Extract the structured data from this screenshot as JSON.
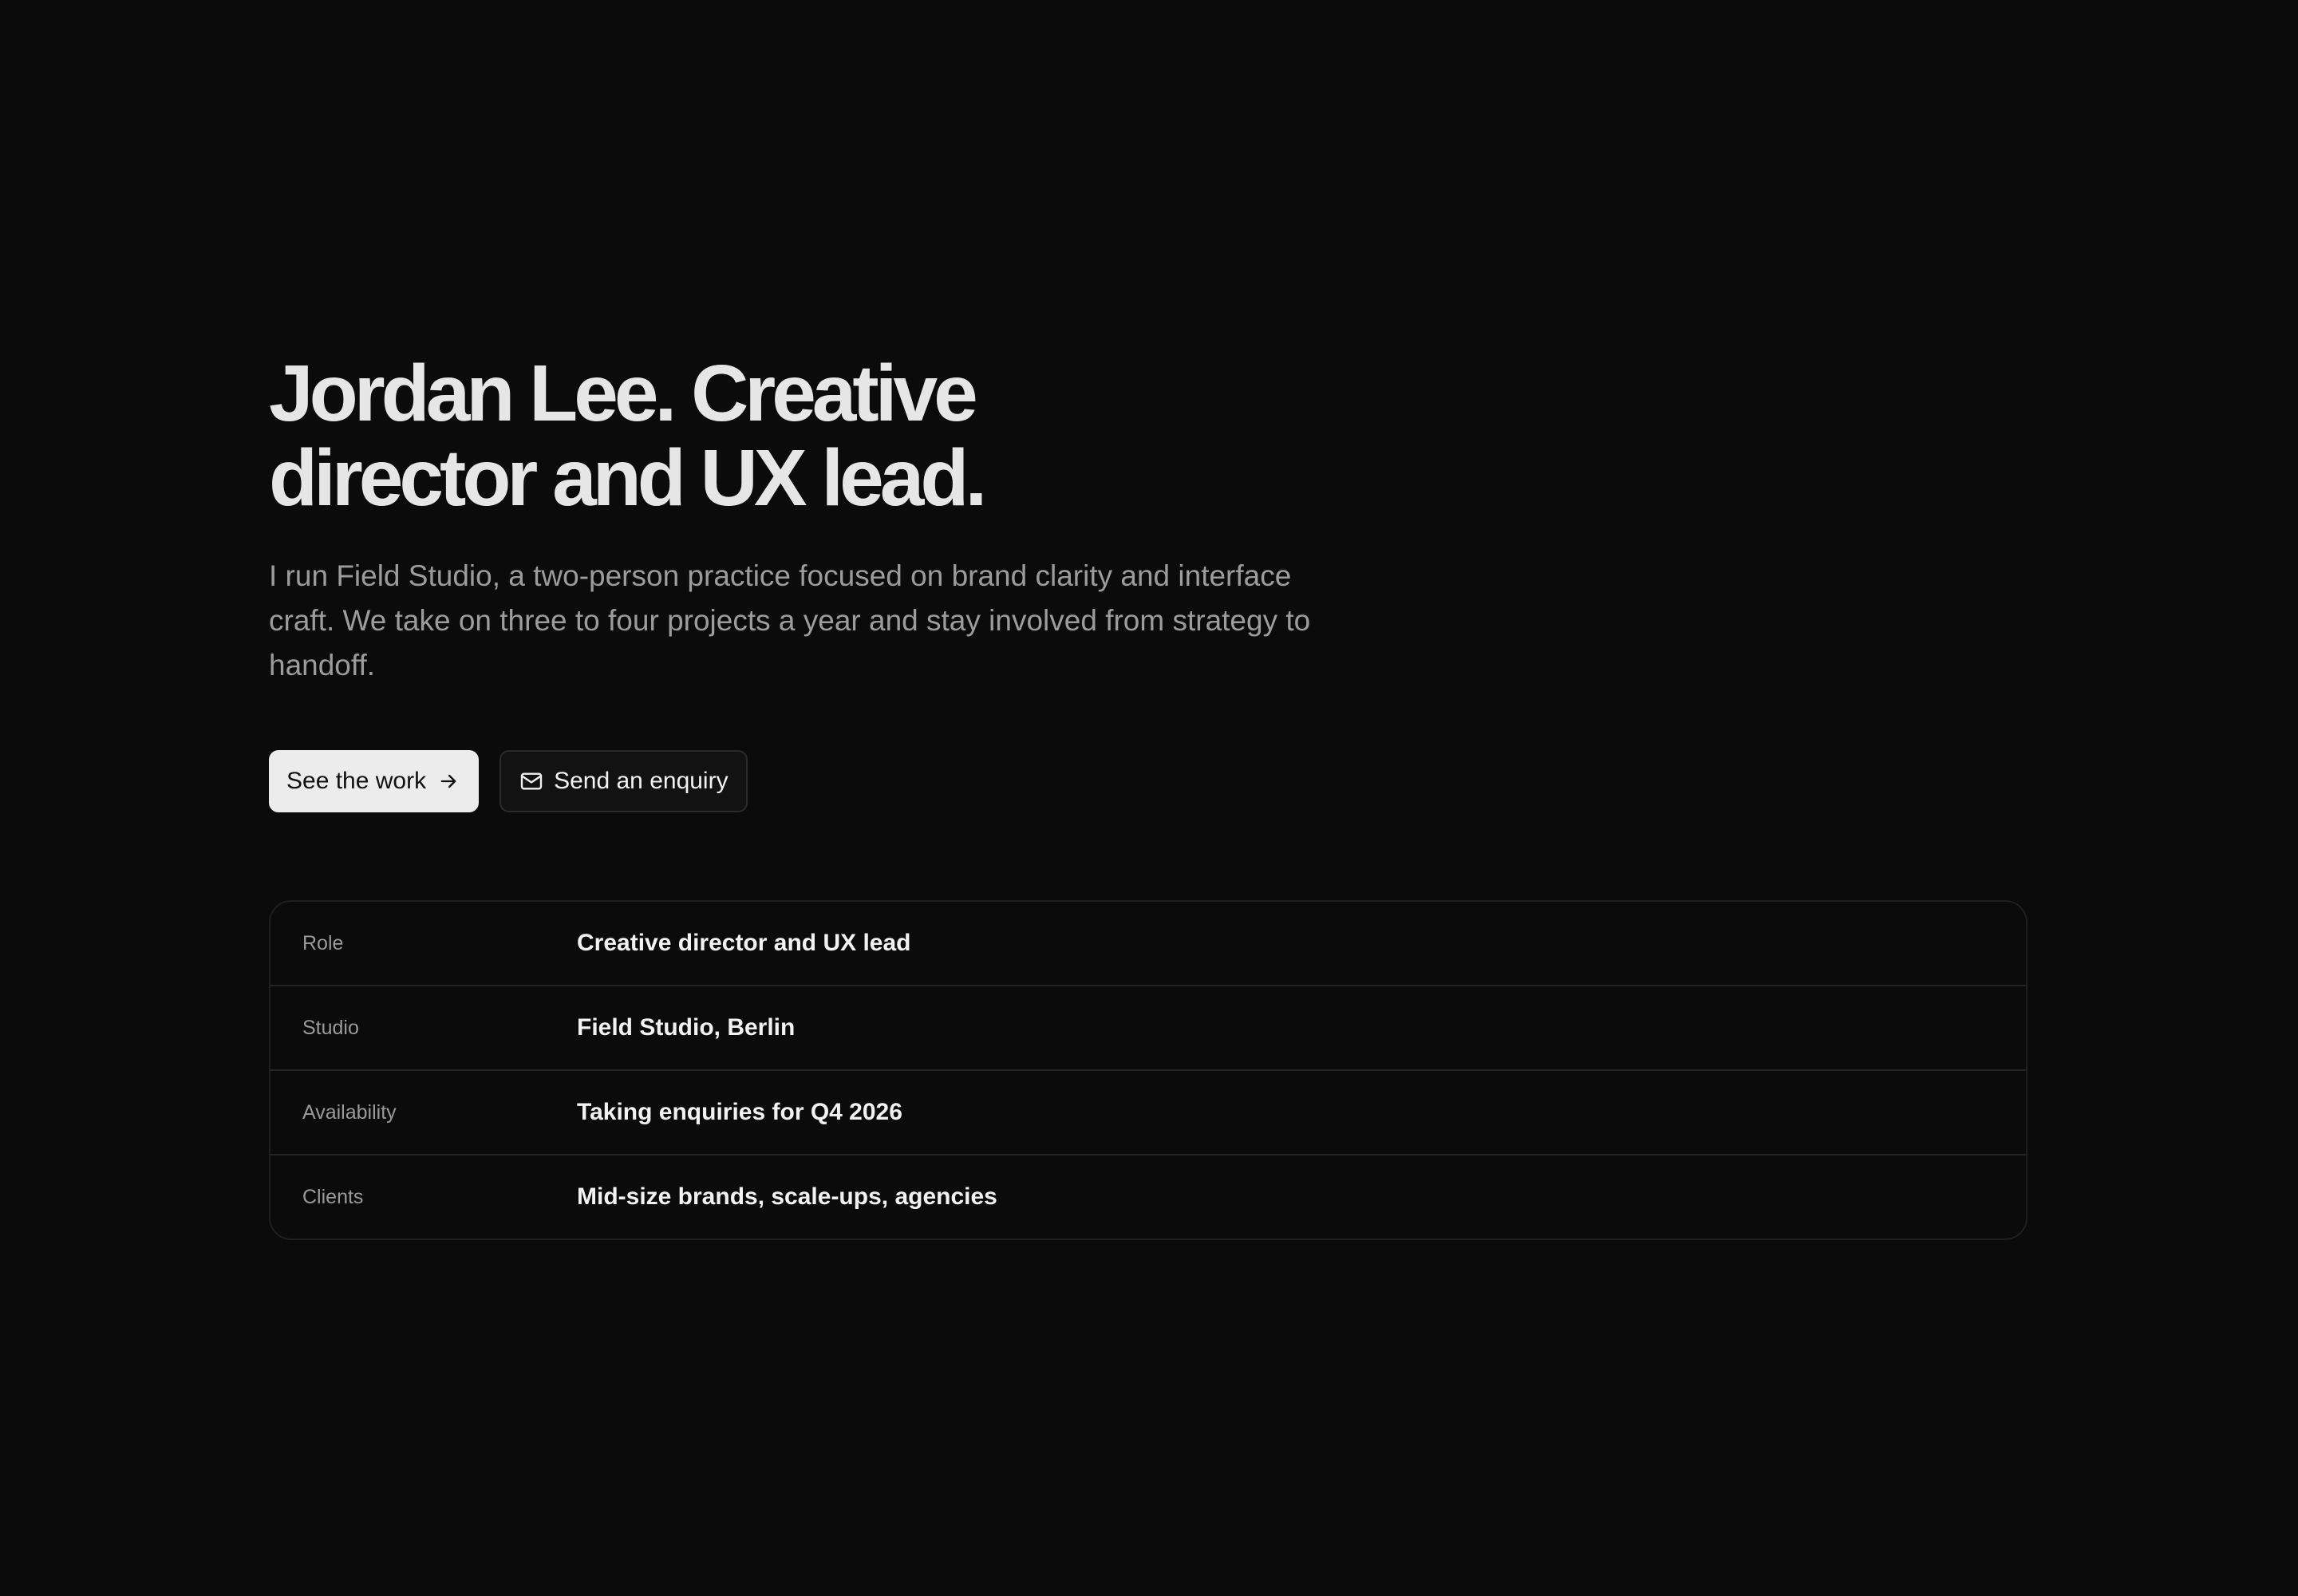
{
  "hero": {
    "headline_line1": "Jordan Lee. Creative",
    "headline_line2": "director and UX lead.",
    "intro": "I run Field Studio, a two-person practice focused on brand clarity and interface craft. We take on three to four projects a year and stay involved from strategy to handoff."
  },
  "actions": {
    "primary_label": "See the work",
    "primary_icon": "arrow-right-icon",
    "secondary_label": "Send an enquiry",
    "secondary_icon": "mail-icon"
  },
  "details": [
    {
      "label": "Role",
      "value": "Creative director and UX lead"
    },
    {
      "label": "Studio",
      "value": "Field Studio, Berlin"
    },
    {
      "label": "Availability",
      "value": "Taking enquiries for Q4 2026"
    },
    {
      "label": "Clients",
      "value": "Mid-size brands, scale-ups, agencies"
    }
  ],
  "colors": {
    "background": "#0b0b0b",
    "headline": "#e6e6e6",
    "body_text": "#9c9c9c",
    "primary_button_bg": "#ececec",
    "border": "#242424"
  }
}
